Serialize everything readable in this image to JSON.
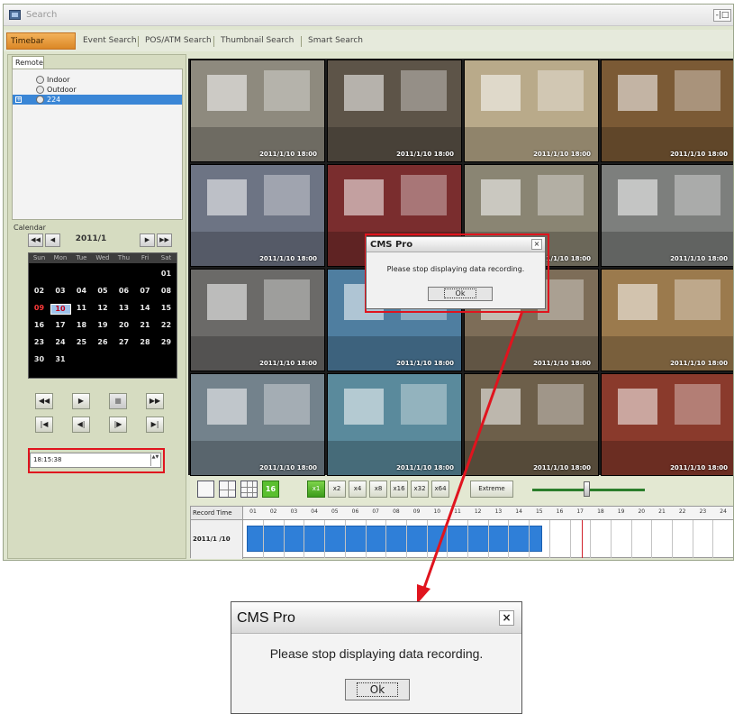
{
  "window": {
    "title": "Search",
    "controls_label": "-|□"
  },
  "tabs": [
    "Timebar Search",
    "Event Search",
    "POS/ATM Search",
    "Thumbnail Search",
    "Smart Search"
  ],
  "remote": {
    "tab_label": "Remote",
    "tree": [
      {
        "label": "Indoor",
        "selected": false
      },
      {
        "label": "Outdoor",
        "selected": false
      },
      {
        "label": "224",
        "selected": true,
        "expander": "+"
      }
    ]
  },
  "calendar": {
    "label": "Calendar",
    "month": "2011/1",
    "nav": [
      "◀◀",
      "◀",
      "▶",
      "▶▶"
    ],
    "weekdays": [
      "Sun",
      "Mon",
      "Tue",
      "Wed",
      "Thu",
      "Fri",
      "Sat"
    ],
    "weeks": [
      [
        "",
        "",
        "",
        "",
        "",
        "",
        "01"
      ],
      [
        "02",
        "03",
        "04",
        "05",
        "06",
        "07",
        "08"
      ],
      [
        "09",
        "10",
        "11",
        "12",
        "13",
        "14",
        "15"
      ],
      [
        "16",
        "17",
        "18",
        "19",
        "20",
        "21",
        "22"
      ],
      [
        "23",
        "24",
        "25",
        "26",
        "27",
        "28",
        "29"
      ],
      [
        "30",
        "31",
        "",
        "",
        "",
        "",
        ""
      ]
    ],
    "selected_day": "10",
    "red_day": "09"
  },
  "playback": {
    "row1": [
      "◀◀",
      "▶",
      "■",
      "▶▶"
    ],
    "row2": [
      "|◀",
      "◀|",
      "|▶",
      "▶|"
    ]
  },
  "time_field": {
    "value": "18:15:38",
    "spin": "▲▼"
  },
  "cameras": [
    {
      "ts": "2011/1/10 18:00",
      "bg": "#8e8a7e"
    },
    {
      "ts": "2011/1/10 18:00",
      "bg": "#5d5448"
    },
    {
      "ts": "2011/1/10 18:00",
      "bg": "#b9aa8a"
    },
    {
      "ts": "2011/1/10 18:00",
      "bg": "#7b5a35"
    },
    {
      "ts": "2011/1/10 18:00",
      "bg": "#6d7484"
    },
    {
      "ts": "2011/1/10 18:00",
      "bg": "#7a2d2e"
    },
    {
      "ts": "2011/1/10 18:00",
      "bg": "#8a8573"
    },
    {
      "ts": "2011/1/10 18:00",
      "bg": "#7d7f7d"
    },
    {
      "ts": "2011/1/10 18:00",
      "bg": "#6b6a68"
    },
    {
      "ts": "2011/1/10 18:00",
      "bg": "#4f7ea0"
    },
    {
      "ts": "2011/1/10 18:00",
      "bg": "#7d6d58"
    },
    {
      "ts": "2011/1/10 18:00",
      "bg": "#9b7a4d"
    },
    {
      "ts": "2011/1/10 18:00",
      "bg": "#73828c"
    },
    {
      "ts": "2011/1/10 18:00",
      "bg": "#5a8a9c"
    },
    {
      "ts": "2011/1/10 18:00",
      "bg": "#6d5f4a"
    },
    {
      "ts": "2011/1/10 18:00",
      "bg": "#8a3a2c"
    }
  ],
  "toolbar": {
    "layout_16": "16",
    "speeds": [
      "x1",
      "x2",
      "x4",
      "x8",
      "x16",
      "x32",
      "x64"
    ],
    "extreme": "Extreme"
  },
  "timeline": {
    "record_label": "Record Time",
    "date": "2011/1 /10",
    "hours": [
      "01",
      "02",
      "03",
      "04",
      "05",
      "06",
      "07",
      "08",
      "09",
      "10",
      "11",
      "12",
      "13",
      "14",
      "15",
      "16",
      "17",
      "18",
      "19",
      "20",
      "21",
      "22",
      "23",
      "24"
    ]
  },
  "dialog": {
    "title": "CMS Pro",
    "close": "×",
    "message": "Please stop displaying data recording.",
    "ok": "Ok"
  }
}
